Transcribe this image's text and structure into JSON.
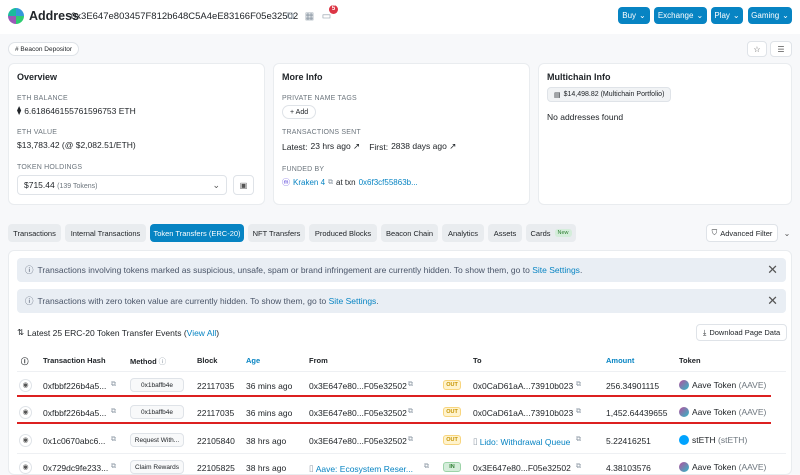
{
  "header": {
    "title": "Address",
    "address": "0x3E647e803457F812b648C5A4eE83166F05e32502",
    "notification_count": "5",
    "buttons": [
      "Buy",
      "Exchange",
      "Play",
      "Gaming"
    ]
  },
  "tag": {
    "label": "# Beacon Depositor"
  },
  "overview": {
    "title": "Overview",
    "eth_balance_label": "ETH BALANCE",
    "eth_balance": "6.618646155761596753 ETH",
    "eth_value_label": "ETH VALUE",
    "eth_value": "$13,783.42 (@ $2,082.51/ETH)",
    "token_holdings_label": "TOKEN HOLDINGS",
    "token_holdings_value": "$715.44",
    "token_holdings_count": "(139 Tokens)"
  },
  "more_info": {
    "title": "More Info",
    "private_tags_label": "PRIVATE NAME TAGS",
    "add_label": "+ Add",
    "tx_sent_label": "TRANSACTIONS SENT",
    "latest_label": "Latest:",
    "latest_value": "23 hrs ago ↗",
    "first_label": "First:",
    "first_value": "2838 days ago ↗",
    "funded_by_label": "FUNDED BY",
    "funded_by_name": "Kraken 4",
    "funded_by_at": "at txn",
    "funded_by_txn": "0x6f3cf55863b..."
  },
  "multichain": {
    "title": "Multichain Info",
    "portfolio": "$14,498.82 (Multichain Portfolio)",
    "no_addresses": "No addresses found"
  },
  "tabs": [
    {
      "label": "Transactions"
    },
    {
      "label": "Internal Transactions"
    },
    {
      "label": "Token Transfers (ERC-20)"
    },
    {
      "label": "NFT Transfers"
    },
    {
      "label": "Produced Blocks"
    },
    {
      "label": "Beacon Chain"
    },
    {
      "label": "Analytics"
    },
    {
      "label": "Assets"
    },
    {
      "label": "Cards"
    }
  ],
  "cards_new": "New",
  "advanced_filter": "Advanced Filter",
  "alerts": [
    {
      "text": "Transactions involving tokens marked as suspicious, unsafe, spam or brand infringement are currently hidden. To show them, go to",
      "link": "Site Settings",
      "end": "."
    },
    {
      "text": "Transactions with zero token value are currently hidden. To show them, go to",
      "link": "Site Settings",
      "end": "."
    }
  ],
  "summary": {
    "text": "Latest 25 ERC-20 Token Transfer Events (",
    "link": "View All",
    "end": ")"
  },
  "download": "Download Page Data",
  "table": {
    "headers": {
      "hash": "Transaction Hash",
      "method": "Method",
      "block": "Block",
      "age": "Age",
      "from": "From",
      "to": "To",
      "amount": "Amount",
      "token": "Token"
    },
    "rows": [
      {
        "hash": "0xfbbf226b4a5...",
        "method": "0x1baffb4e",
        "block": "22117035",
        "age": "36 mins ago",
        "from": "0x3E647e80...F05e32502",
        "dir": "OUT",
        "to": "0x0CaD61aA...73910b023",
        "amount": "256.34901115",
        "token": "Aave Token (AAVE)",
        "token_name": "Aave Token",
        "token_sym": "(AAVE)"
      },
      {
        "hash": "0xfbbf226b4a5...",
        "method": "0x1baffb4e",
        "block": "22117035",
        "age": "36 mins ago",
        "from": "0x3E647e80...F05e32502",
        "dir": "OUT",
        "to": "0x0CaD61aA...73910b023",
        "amount": "1,452.64439655",
        "token": "Aave Token (AAVE)",
        "token_name": "Aave Token",
        "token_sym": "(AAVE)"
      },
      {
        "hash": "0x1c0670abc6...",
        "method": "Request With...",
        "block": "22105840",
        "age": "38 hrs ago",
        "from": "0x3E647e80...F05e32502",
        "dir": "OUT",
        "to": "Lido: Withdrawal Queue",
        "amount": "5.22416251",
        "token": "stETH (stETH)",
        "token_name": "stETH",
        "token_sym": "(stETH)"
      },
      {
        "hash": "0x729dc9fe233...",
        "method": "Claim Rewards",
        "block": "22105825",
        "age": "38 hrs ago",
        "from": "Aave: Ecosystem Reser...",
        "dir": "IN",
        "to": "0x3E647e80...F05e32502",
        "amount": "4.38103576",
        "token": "Aave Token (AAVE)",
        "token_name": "Aave Token",
        "token_sym": "(AAVE)"
      }
    ]
  },
  "colors": {
    "accent": "#0784c3",
    "highlight_line": "#dc2020"
  }
}
